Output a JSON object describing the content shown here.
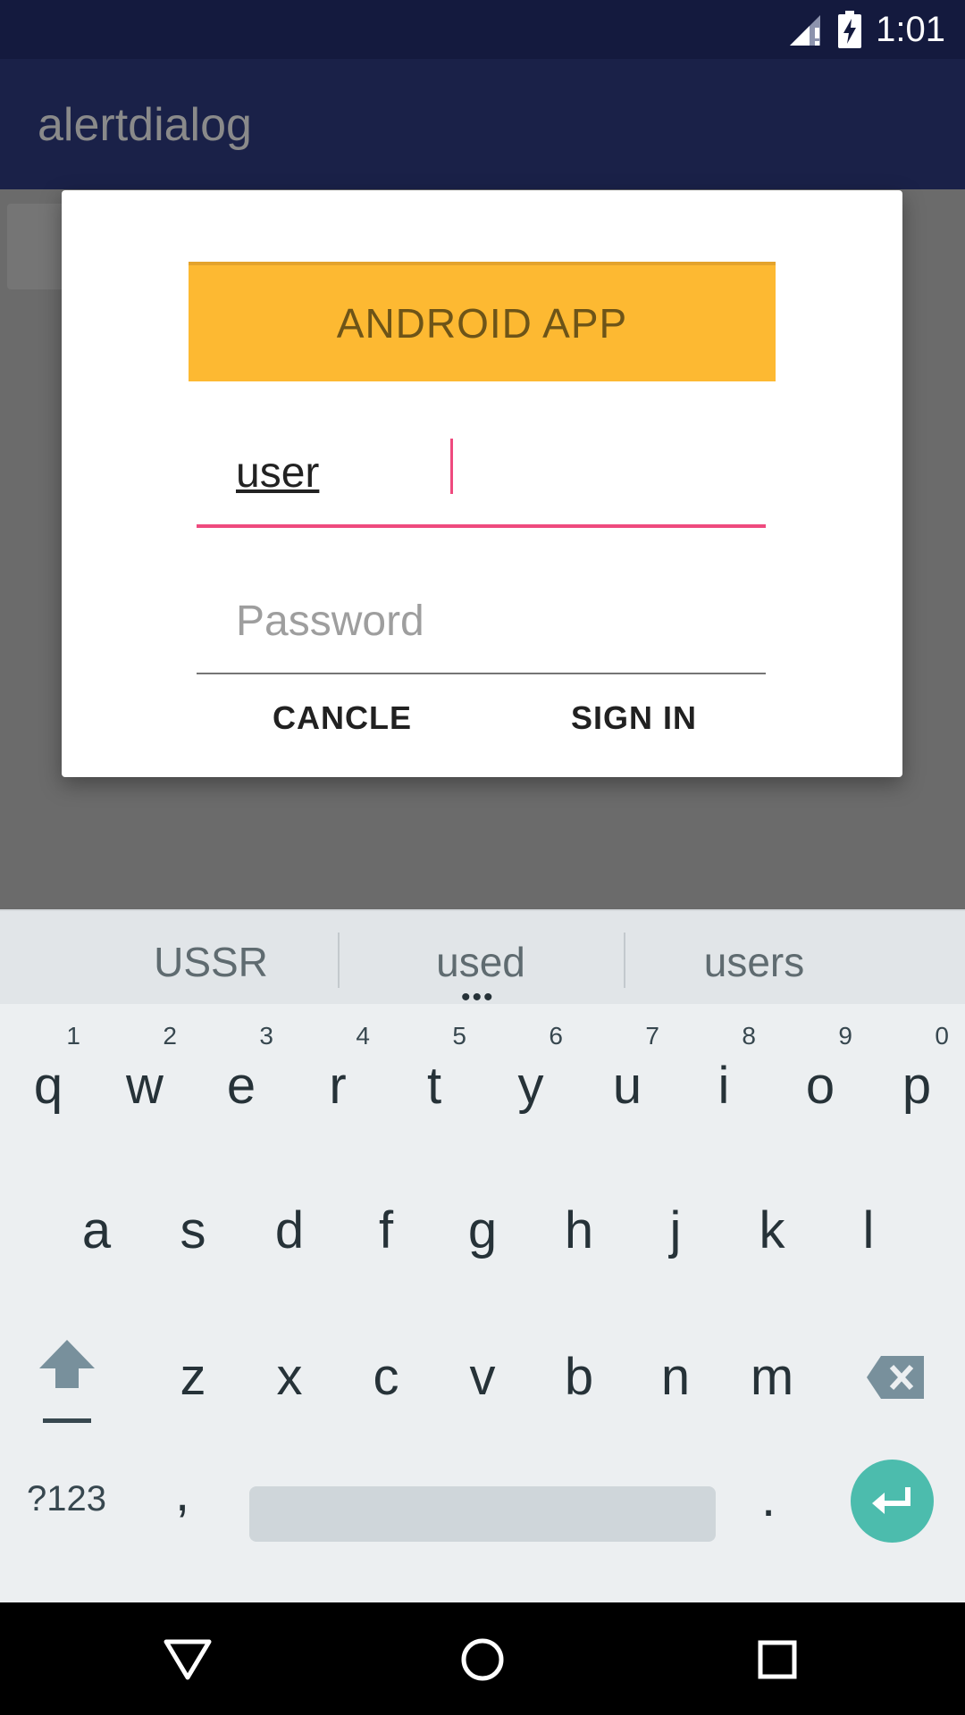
{
  "status_bar": {
    "time": "1:01",
    "icons": [
      "signal-icon",
      "battery-charging-icon"
    ]
  },
  "app_bar": {
    "title": "alertdialog"
  },
  "dialog": {
    "header": "ANDROID APP",
    "username": {
      "value": "user",
      "placeholder": ""
    },
    "password": {
      "value": "",
      "placeholder": "Password"
    },
    "buttons": {
      "cancel": "CANCLE",
      "sign_in": "SIGN IN"
    }
  },
  "keyboard": {
    "suggestions": [
      "USSR",
      "used",
      "users"
    ],
    "rows": [
      [
        {
          "char": "q",
          "hint": "1"
        },
        {
          "char": "w",
          "hint": "2"
        },
        {
          "char": "e",
          "hint": "3"
        },
        {
          "char": "r",
          "hint": "4"
        },
        {
          "char": "t",
          "hint": "5"
        },
        {
          "char": "y",
          "hint": "6"
        },
        {
          "char": "u",
          "hint": "7"
        },
        {
          "char": "i",
          "hint": "8"
        },
        {
          "char": "o",
          "hint": "9"
        },
        {
          "char": "p",
          "hint": "0"
        }
      ],
      [
        {
          "char": "a"
        },
        {
          "char": "s"
        },
        {
          "char": "d"
        },
        {
          "char": "f"
        },
        {
          "char": "g"
        },
        {
          "char": "h"
        },
        {
          "char": "j"
        },
        {
          "char": "k"
        },
        {
          "char": "l"
        }
      ],
      [
        {
          "char": "z"
        },
        {
          "char": "x"
        },
        {
          "char": "c"
        },
        {
          "char": "v"
        },
        {
          "char": "b"
        },
        {
          "char": "n"
        },
        {
          "char": "m"
        }
      ]
    ],
    "bottom": {
      "symbols": "?123",
      "comma": ",",
      "period": "."
    },
    "icons": [
      "shift-icon",
      "backspace-icon",
      "enter-icon"
    ]
  },
  "nav_bar": {
    "icons": [
      "back-icon",
      "home-icon",
      "recent-apps-icon"
    ]
  },
  "colors": {
    "status_bar": "#141a3e",
    "header": "#fdb932",
    "accent": "#ef4a7e",
    "enter_key": "#4cbcad"
  }
}
